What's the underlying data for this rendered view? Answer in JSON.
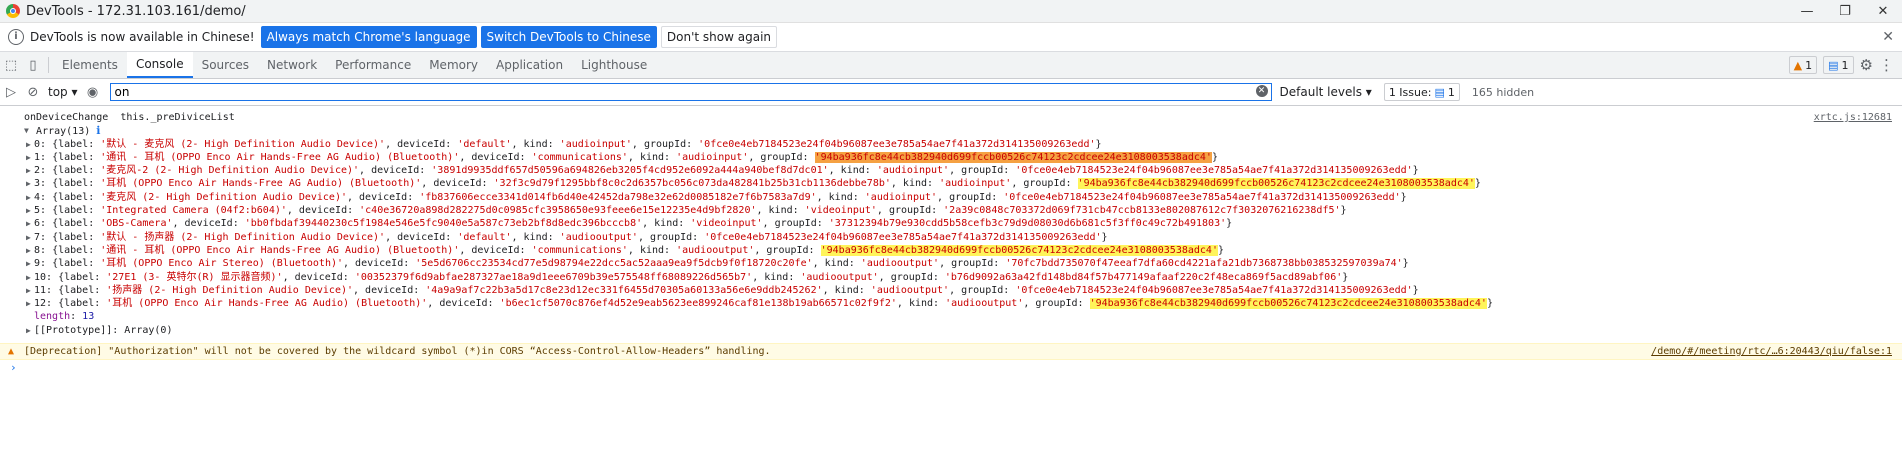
{
  "window": {
    "title": "DevTools - 172.31.103.161/demo/"
  },
  "infobar": {
    "text": "DevTools is now available in Chinese!",
    "btn_match": "Always match Chrome's language",
    "btn_switch": "Switch DevTools to Chinese",
    "btn_dismiss": "Don't show again"
  },
  "tabs": [
    "Elements",
    "Console",
    "Sources",
    "Network",
    "Performance",
    "Memory",
    "Application",
    "Lighthouse"
  ],
  "badges": {
    "warnings": "1",
    "messages": "1"
  },
  "filter": {
    "context": "top",
    "value": "on",
    "levels": "Default levels",
    "issues_label": "1 Issue:",
    "issues_count": "1",
    "hidden": "165 hidden"
  },
  "log": {
    "head_a": "onDeviceChange",
    "head_b": "this._preDiviceList",
    "source": "xrtc.js:12681",
    "array_label": "Array(13)",
    "length_key": "length",
    "length_val": "13",
    "proto": "[[Prototype]]: Array(0)",
    "items": [
      {
        "i": "0",
        "label": "'默认 - 麦克风 (2- High Definition Audio Device)'",
        "deviceId": "'default'",
        "kind": "'audioinput'",
        "groupId": "'0fce0e4eb7184523e24f04b96087ee3e785a54ae7f41a372d314135009263edd'",
        "hl": ""
      },
      {
        "i": "1",
        "label": "'通讯 - 耳机 (OPPO Enco Air Hands-Free AG Audio) (Bluetooth)'",
        "deviceId": "'communications'",
        "kind": "'audioinput'",
        "groupId": "'94ba936fc8e44cb382940d699fccb00526c74123c2cdcee24e3108003538adc4'",
        "hl": "orange"
      },
      {
        "i": "2",
        "label": "'麦克风-2 (2- High Definition Audio Device)'",
        "deviceId": "'3891d9935ddf657d50596a694826eb3205f4cd952e6092a444a940bef8d7dc01'",
        "kind": "'audioinput'",
        "groupId": "'0fce0e4eb7184523e24f04b96087ee3e785a54ae7f41a372d314135009263edd'",
        "hl": ""
      },
      {
        "i": "3",
        "label": "'耳机 (OPPO Enco Air Hands-Free AG Audio) (Bluetooth)'",
        "deviceId": "'32f3c9d79f1295bbf8c0c2d6357bc056c073da482841b25b31cb1136debbe78b'",
        "kind": "'audioinput'",
        "groupId": "'94ba936fc8e44cb382940d699fccb00526c74123c2cdcee24e3108003538adc4'",
        "hl": "yellow"
      },
      {
        "i": "4",
        "label": "'麦克风 (2- High Definition Audio Device)'",
        "deviceId": "'fb837606ecce3341d014fb6d40e42452da798e32e62d0085182e7f6b7583a7d9'",
        "kind": "'audioinput'",
        "groupId": "'0fce0e4eb7184523e24f04b96087ee3e785a54ae7f41a372d314135009263edd'",
        "hl": ""
      },
      {
        "i": "5",
        "label": "'Integrated Camera (04f2:b604)'",
        "deviceId": "'c40e36720a898d282275d0c0985cfc3958650e93feee6e15e12235e4d9bf2820'",
        "kind": "'videoinput'",
        "groupId": "'2a39c0848c703372d069f731cb47ccb8133e802087612c7f3032076216238df5'",
        "hl": ""
      },
      {
        "i": "6",
        "label": "'OBS-Camera'",
        "deviceId": "'bb0fbdaf39440230c5f1984e546e5fc9040e5a587c73eb2bf8d8edc396bcccb8'",
        "kind": "'videoinput'",
        "groupId": "'37312394b79e930cdd5b58cefb3c79d9d08030d6b681c5f3ff0c49c72b491803'",
        "hl": ""
      },
      {
        "i": "7",
        "label": "'默认 - 扬声器 (2- High Definition Audio Device)'",
        "deviceId": "'default'",
        "kind": "'audiooutput'",
        "groupId": "'0fce0e4eb7184523e24f04b96087ee3e785a54ae7f41a372d314135009263edd'",
        "hl": ""
      },
      {
        "i": "8",
        "label": "'通讯 - 耳机 (OPPO Enco Air Hands-Free AG Audio) (Bluetooth)'",
        "deviceId": "'communications'",
        "kind": "'audiooutput'",
        "groupId": "'94ba936fc8e44cb382940d699fccb00526c74123c2cdcee24e3108003538adc4'",
        "hl": "yellow"
      },
      {
        "i": "9",
        "label": "'耳机 (OPPO Enco Air Stereo) (Bluetooth)'",
        "deviceId": "'5e5d6706cc23534cd77e5d98794e22dcc5ac52aaa9ea9f5dcb9f0f18720c20fe'",
        "kind": "'audiooutput'",
        "groupId": "'70fc7bdd735070f47eeaf7dfa60cd4221afa21db7368738bb038532597039a74'",
        "hl": ""
      },
      {
        "i": "10",
        "label": "'27E1 (3- 英特尔(R) 显示器音频)'",
        "deviceId": "'00352379f6d9abfae287327ae18a9d1eee6709b39e575548ff68089226d565b7'",
        "kind": "'audiooutput'",
        "groupId": "'b76d9092a63a42fd148bd84f57b477149afaaf220c2f48eca869f5acd89abf06'",
        "hl": ""
      },
      {
        "i": "11",
        "label": "'扬声器 (2- High Definition Audio Device)'",
        "deviceId": "'4a9a9af7c22b3a5d17c8e23d12ec331f6455d70305a60133a56e6e9ddb245262'",
        "kind": "'audiooutput'",
        "groupId": "'0fce0e4eb7184523e24f04b96087ee3e785a54ae7f41a372d314135009263edd'",
        "hl": ""
      },
      {
        "i": "12",
        "label": "'耳机 (OPPO Enco Air Hands-Free AG Audio) (Bluetooth)'",
        "deviceId": "'b6ec1cf5070c876ef4d52e9eab5623ee899246caf81e138b19ab66571c02f9f2'",
        "kind": "'audiooutput'",
        "groupId": "'94ba936fc8e44cb382940d699fccb00526c74123c2cdcee24e3108003538adc4'",
        "hl": "yellow"
      }
    ]
  },
  "warning": {
    "text": "[Deprecation] \"Authorization\" will not be covered by the wildcard symbol (*)in CORS “Access-Control-Allow-Headers” handling.",
    "source": "/demo/#/meeting/rtc/…6:20443/qiu/false:1"
  },
  "prompt_symbol": "›"
}
